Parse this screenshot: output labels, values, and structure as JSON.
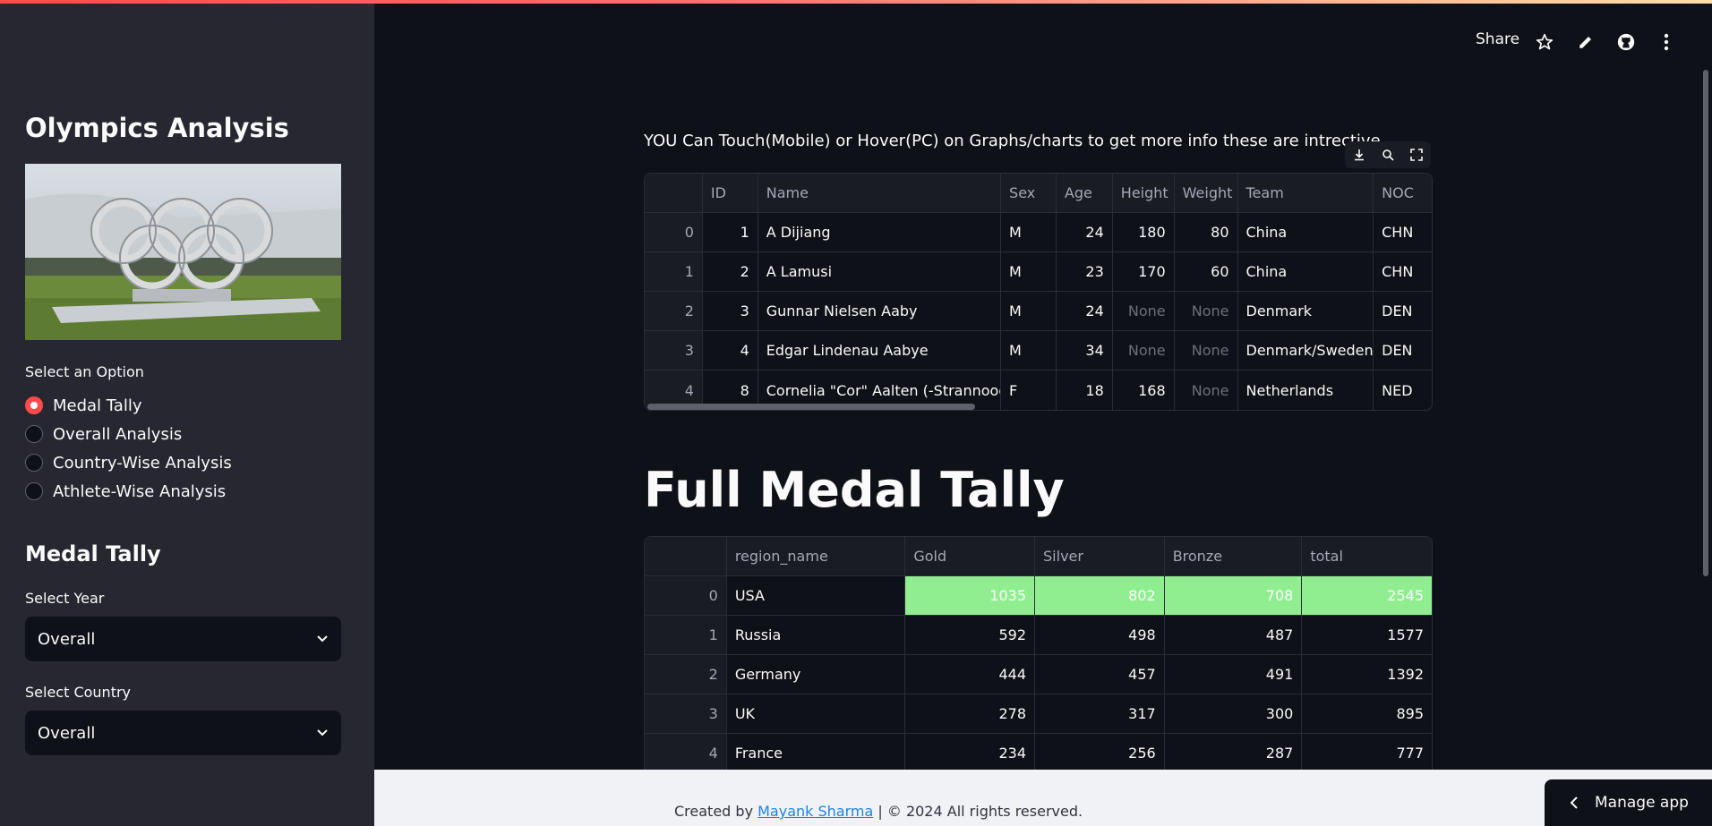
{
  "sidebar": {
    "title": "Olympics Analysis",
    "option_label": "Select an Option",
    "options": [
      "Medal Tally",
      "Overall Analysis",
      "Country-Wise Analysis",
      "Athlete-Wise Analysis"
    ],
    "selected_option": "Medal Tally",
    "section_title": "Medal Tally",
    "year_label": "Select Year",
    "year_value": "Overall",
    "country_label": "Select Country",
    "country_value": "Overall"
  },
  "header": {
    "share_label": "Share",
    "icons": [
      "star-icon",
      "pencil-icon",
      "github-icon",
      "more-vertical-icon"
    ]
  },
  "main": {
    "hint": "YOU Can Touch(Mobile) or Hover(PC) on Graphs/charts to get more info these are intrective",
    "athlete_table": {
      "columns": [
        "",
        "ID",
        "Name",
        "Sex",
        "Age",
        "Height",
        "Weight",
        "Team",
        "NOC"
      ],
      "rows": [
        [
          "0",
          "1",
          "A Dijiang",
          "M",
          "24",
          "180",
          "80",
          "China",
          "CHN"
        ],
        [
          "1",
          "2",
          "A Lamusi",
          "M",
          "23",
          "170",
          "60",
          "China",
          "CHN"
        ],
        [
          "2",
          "3",
          "Gunnar Nielsen Aaby",
          "M",
          "24",
          "None",
          "None",
          "Denmark",
          "DEN"
        ],
        [
          "3",
          "4",
          "Edgar Lindenau Aabye",
          "M",
          "34",
          "None",
          "None",
          "Denmark/Sweden",
          "DEN"
        ],
        [
          "4",
          "8",
          "Cornelia \"Cor\" Aalten (-Strannood)",
          "F",
          "18",
          "168",
          "None",
          "Netherlands",
          "NED"
        ]
      ]
    },
    "medal_title": "Full Medal Tally",
    "medal_table": {
      "columns": [
        "",
        "region_name",
        "Gold",
        "Silver",
        "Bronze",
        "total"
      ],
      "rows": [
        [
          "0",
          "USA",
          "1035",
          "802",
          "708",
          "2545"
        ],
        [
          "1",
          "Russia",
          "592",
          "498",
          "487",
          "1577"
        ],
        [
          "2",
          "Germany",
          "444",
          "457",
          "491",
          "1392"
        ],
        [
          "3",
          "UK",
          "278",
          "317",
          "300",
          "895"
        ],
        [
          "4",
          "France",
          "234",
          "256",
          "287",
          "777"
        ]
      ],
      "highlight_color": "#90ee90"
    }
  },
  "footer": {
    "prefix": "Created by ",
    "author": "Mayank Sharma",
    "suffix": " | © 2024 All rights reserved."
  },
  "manage_app": "Manage app",
  "colors": {
    "accent": "#ff4b4b",
    "sidebar_bg": "#262730",
    "main_bg": "#0e1117"
  }
}
